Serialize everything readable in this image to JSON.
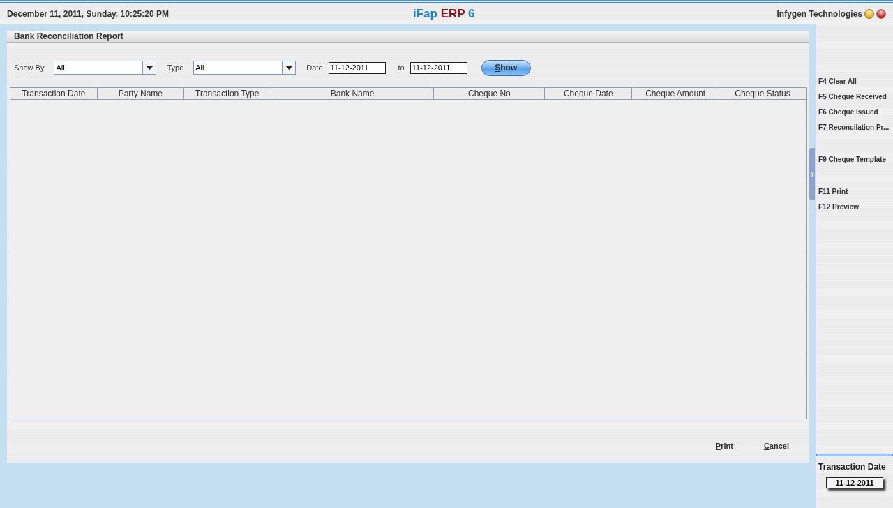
{
  "header": {
    "datetime": "December  11, 2011, Sunday, 10:25:20 PM",
    "app_title": {
      "part_1": "iFap",
      "part_2": "ERP",
      "part_3": "6"
    },
    "company": "Infygen Technologies"
  },
  "report": {
    "title": "Bank Reconciliation Report",
    "filters": {
      "show_by": {
        "label": "Show By",
        "value": "All"
      },
      "type": {
        "label": "Type",
        "value": "All"
      },
      "date": {
        "label": "Date",
        "from": "11-12-2011",
        "to_label": "to",
        "to": "11-12-2011"
      },
      "show_button": "Show"
    },
    "table": {
      "columns": [
        "Transaction Date",
        "Party Name",
        "Transaction Type",
        "Bank Name",
        "Cheque No",
        "Cheque Date",
        "Cheque Amount",
        "Cheque Status"
      ]
    },
    "buttons": [
      "Print",
      "Cancel"
    ]
  },
  "sidebar": {
    "shortcuts": [
      "F4 Clear All",
      "F5 Cheque Received",
      "F6 Cheque Issued",
      "F7 Reconcilation Pr...",
      "F9 Cheque Template",
      "F11 Print",
      "F12 Preview"
    ],
    "info": {
      "label": "Transaction Date",
      "value": "11-12-2011"
    }
  }
}
